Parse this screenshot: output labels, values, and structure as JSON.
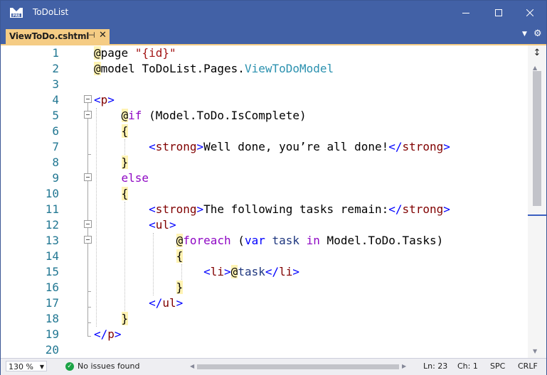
{
  "window": {
    "title": "ToDoList",
    "app_icon": "vs-pre-icon",
    "controls": {
      "minimize": "minimize-icon",
      "maximize": "maximize-icon",
      "close": "close-icon"
    }
  },
  "tab": {
    "label": "ViewToDo.cshtml",
    "pin_icon": "pin-icon",
    "close_icon": "close-icon"
  },
  "editor": {
    "line_numbers": [
      "1",
      "2",
      "3",
      "4",
      "5",
      "6",
      "7",
      "8",
      "9",
      "10",
      "11",
      "12",
      "13",
      "14",
      "15",
      "16",
      "17",
      "18",
      "19",
      "20"
    ],
    "lines": [
      "@page \"{id}\"",
      "@model ToDoList.Pages.ViewToDoModel",
      "",
      "<p>",
      "    @if (Model.ToDo.IsComplete)",
      "    {",
      "        <strong>Well done, you’re all done!</strong>",
      "    }",
      "    else",
      "    {",
      "        <strong>The following tasks remain:</strong>",
      "        <ul>",
      "            @foreach (var task in Model.ToDo.Tasks)",
      "            {",
      "                <li>@task</li>",
      "            }",
      "        </ul>",
      "    }",
      "</p>",
      ""
    ]
  },
  "status": {
    "zoom": "130 %",
    "issues": "No issues found",
    "line": "Ln: 23",
    "col": "Ch: 1",
    "whitespace": "SPC",
    "line_ending": "CRLF"
  },
  "colors": {
    "title_bar": "#4261a6",
    "active_tab": "#f5cc84",
    "razor_highlight": "#fff3b3",
    "line_number": "#237893",
    "ok_icon": "#1ba345"
  }
}
